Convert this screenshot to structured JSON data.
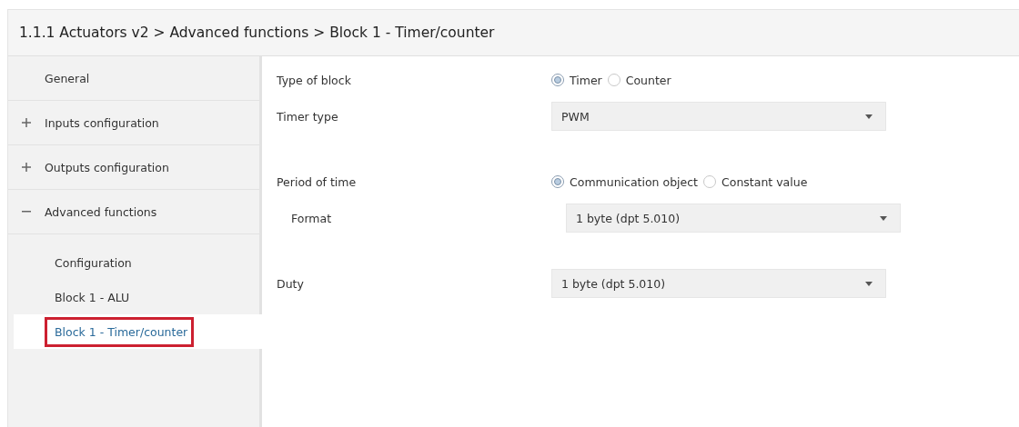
{
  "breadcrumb": "1.1.1 Actuators v2 > Advanced functions > Block 1 - Timer/counter",
  "sidebar": {
    "items": [
      {
        "label": "General"
      },
      {
        "label": "Inputs configuration",
        "expanded": false
      },
      {
        "label": "Outputs configuration",
        "expanded": false
      },
      {
        "label": "Advanced functions",
        "expanded": true,
        "children": [
          {
            "label": "Configuration",
            "selected": false,
            "highlighted": false
          },
          {
            "label": "Block 1 - ALU",
            "selected": false,
            "highlighted": false
          },
          {
            "label": "Block 1 - Timer/counter",
            "selected": true,
            "highlighted": true
          }
        ]
      }
    ]
  },
  "sections": [
    [
      {
        "label": "Type of block",
        "kind": "radio",
        "options": [
          {
            "label": "Timer",
            "selected": true
          },
          {
            "label": "Counter",
            "selected": false
          }
        ]
      },
      {
        "label": "Timer type",
        "kind": "select",
        "value": "PWM"
      }
    ],
    [
      {
        "label": "Period of time",
        "kind": "radio",
        "options": [
          {
            "label": "Communication object",
            "selected": true
          },
          {
            "label": "Constant value",
            "selected": false
          }
        ],
        "children": [
          {
            "label": "Format",
            "kind": "select",
            "value": "1 byte (dpt 5.010)"
          }
        ]
      }
    ],
    [
      {
        "label": "Duty",
        "kind": "select",
        "value": "1 byte (dpt 5.010)"
      }
    ]
  ]
}
